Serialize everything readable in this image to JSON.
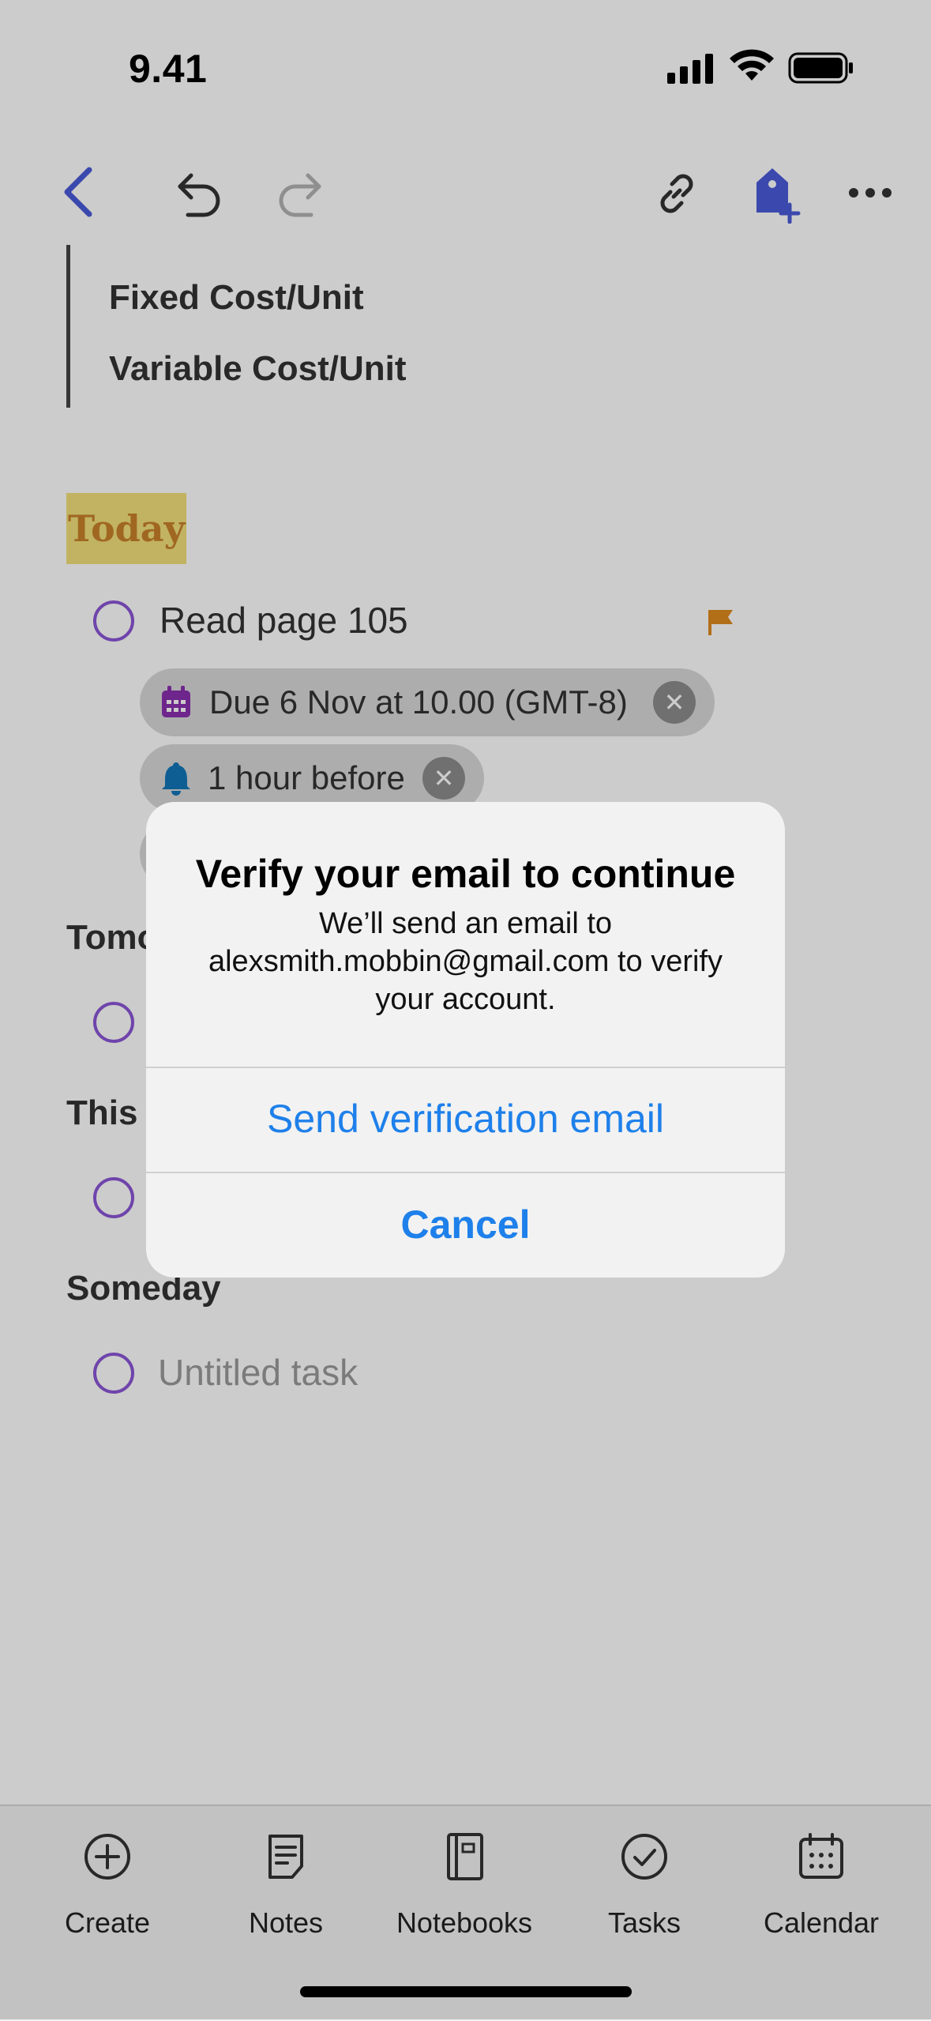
{
  "status_bar": {
    "time": "9.41"
  },
  "note": {
    "quote_lines": [
      "Fixed Cost/Unit",
      "Variable Cost/Unit"
    ],
    "today_heading": "Today",
    "task_today": {
      "title": "Read page 105",
      "due_chip": "Due 6 Nov at 10.00 (GMT-8)",
      "reminder_chip": "1 hour before"
    },
    "sections": {
      "tomorrow_partial": "Tomo",
      "this_partial": "This",
      "someday": "Someday"
    },
    "untitled_task_placeholder": "Untitled task"
  },
  "dialog": {
    "title": "Verify your email to continue",
    "message": "We’ll send an email to alexsmith.mobbin@gmail.com to verify your account.",
    "primary_button": "Send verification email",
    "cancel_button": "Cancel"
  },
  "bottom_nav": {
    "create": "Create",
    "notes": "Notes",
    "notebooks": "Notebooks",
    "tasks": "Tasks",
    "calendar": "Calendar"
  },
  "colors": {
    "accent_blue": "#4a5bd9",
    "task_circle": "#8b55d6",
    "flag": "#e08a1e",
    "dialog_button": "#1e80ea",
    "calendar_chip_icon": "#8a2fb0",
    "bell_chip_icon": "#1276b8"
  },
  "icons": [
    "back-icon",
    "undo-icon",
    "redo-icon",
    "link-icon",
    "tag-add-icon",
    "more-icon",
    "flag-icon",
    "calendar-icon",
    "bell-icon",
    "plus-circle-icon",
    "note-icon",
    "notebook-icon",
    "check-circle-icon",
    "calendar-nav-icon"
  ]
}
